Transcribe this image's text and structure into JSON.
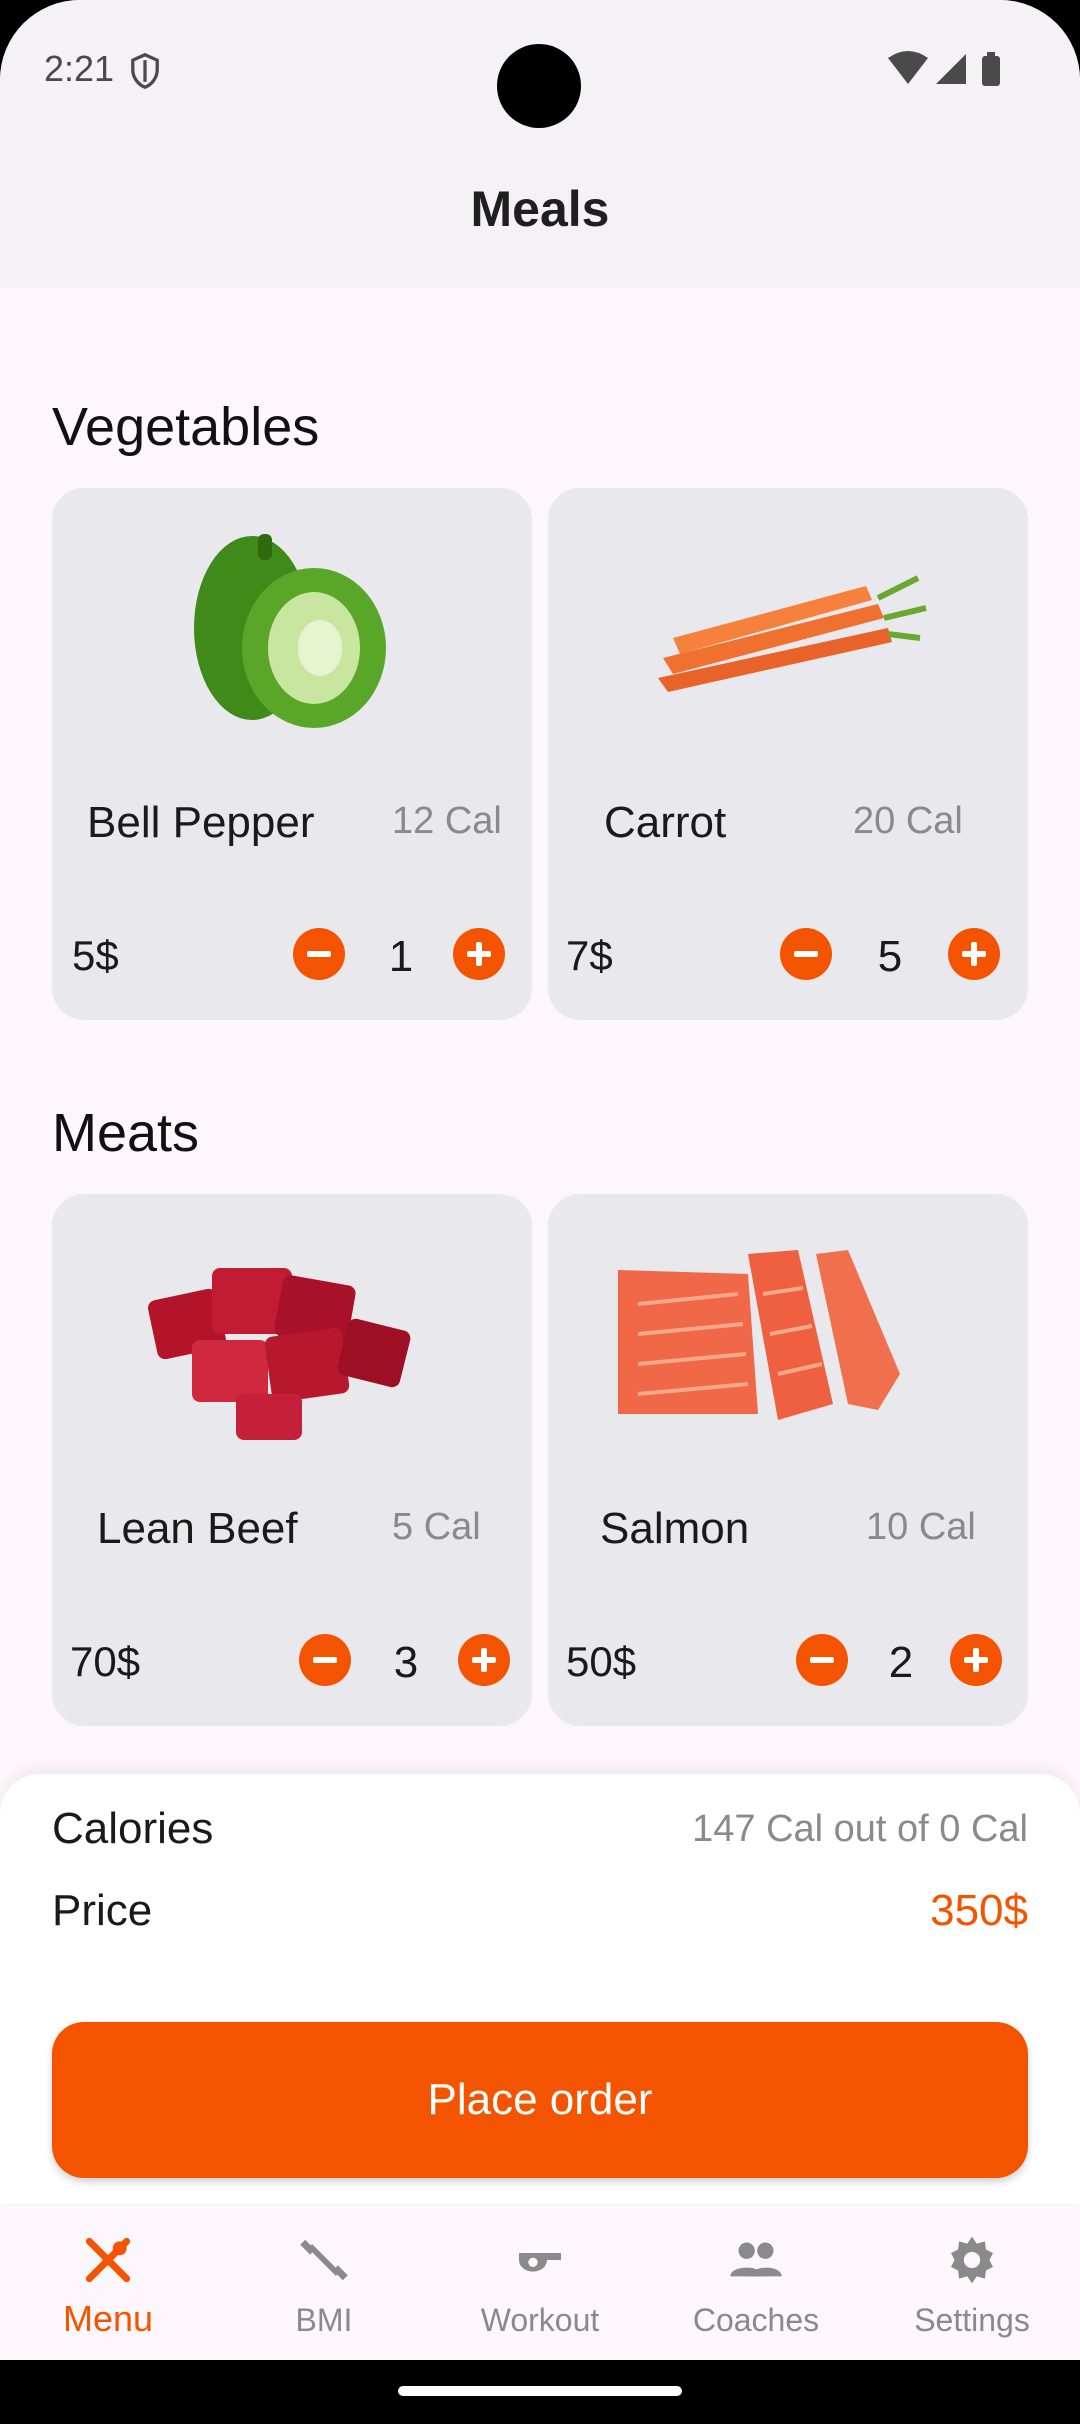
{
  "status_bar": {
    "time": "2:21"
  },
  "header": {
    "title": "Meals"
  },
  "sections": [
    {
      "title": "Vegetables",
      "items": [
        {
          "name": "Bell Pepper",
          "calories": "12 Cal",
          "price": "5$",
          "quantity": "1",
          "image": "bell-pepper"
        },
        {
          "name": "Carrot",
          "calories": "20 Cal",
          "price": "7$",
          "quantity": "5",
          "image": "carrot"
        }
      ]
    },
    {
      "title": "Meats",
      "items": [
        {
          "name": "Lean Beef",
          "calories": "5 Cal",
          "price": "70$",
          "quantity": "3",
          "image": "beef"
        },
        {
          "name": "Salmon",
          "calories": "10 Cal",
          "price": "50$",
          "quantity": "2",
          "image": "salmon"
        }
      ]
    }
  ],
  "summary": {
    "calories_label": "Calories",
    "calories_value": "147  Cal out of 0 Cal",
    "price_label": "Price",
    "price_value": "350$",
    "order_button": "Place order"
  },
  "bottom_nav": [
    {
      "label": "Menu",
      "icon": "fork-spoon-icon",
      "active": true
    },
    {
      "label": "BMI",
      "icon": "dumbbell-icon",
      "active": false
    },
    {
      "label": "Workout",
      "icon": "whistle-icon",
      "active": false
    },
    {
      "label": "Coaches",
      "icon": "people-icon",
      "active": false
    },
    {
      "label": "Settings",
      "icon": "gear-icon",
      "active": false
    }
  ],
  "colors": {
    "accent": "#f45400",
    "card": "#e9e8ec",
    "background": "#fdf7fc"
  }
}
